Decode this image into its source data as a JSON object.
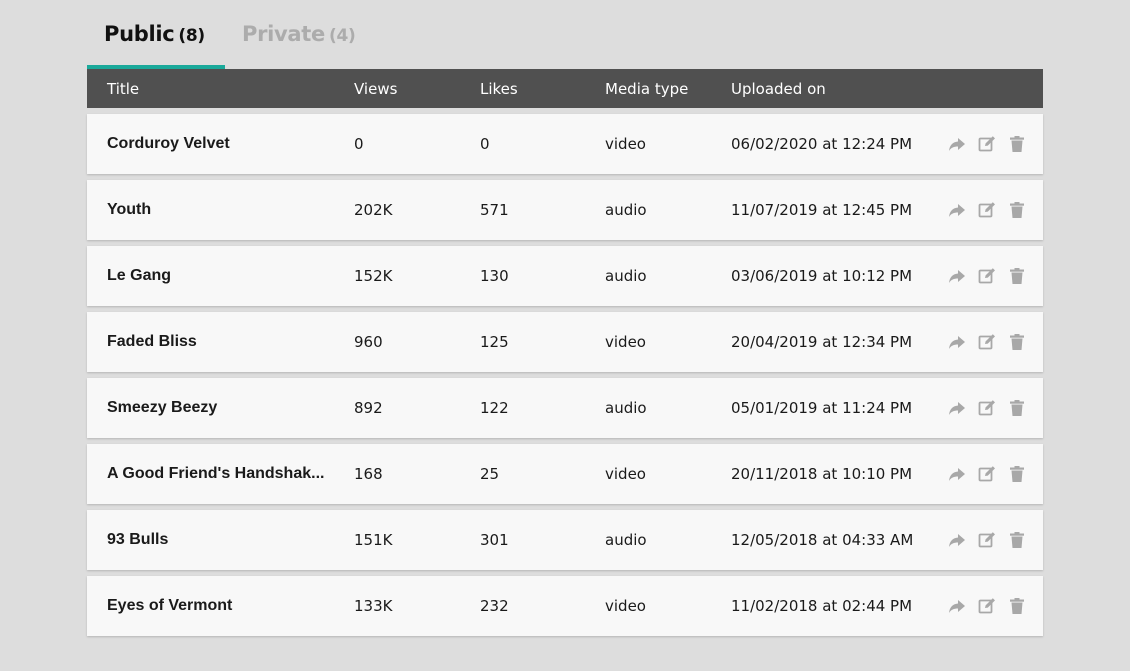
{
  "tabs": [
    {
      "label": "Public",
      "count": "(8)"
    },
    {
      "label": "Private",
      "count": "(4)"
    }
  ],
  "columns": [
    "Title",
    "Views",
    "Likes",
    "Media type",
    "Uploaded on"
  ],
  "rows": [
    {
      "title": "Corduroy Velvet",
      "views": "0",
      "likes": "0",
      "media": "video",
      "uploaded": "06/02/2020 at 12:24 PM"
    },
    {
      "title": "Youth",
      "views": "202K",
      "likes": "571",
      "media": "audio",
      "uploaded": "11/07/2019 at 12:45 PM"
    },
    {
      "title": "Le Gang",
      "views": "152K",
      "likes": "130",
      "media": "audio",
      "uploaded": "03/06/2019 at 10:12 PM"
    },
    {
      "title": "Faded Bliss",
      "views": "960",
      "likes": "125",
      "media": "video",
      "uploaded": "20/04/2019 at 12:34 PM"
    },
    {
      "title": "Smeezy Beezy",
      "views": "892",
      "likes": "122",
      "media": "audio",
      "uploaded": "05/01/2019 at 11:24 PM"
    },
    {
      "title": "A Good Friend's Handshak...",
      "views": "168",
      "likes": "25",
      "media": "video",
      "uploaded": "20/11/2018 at 10:10 PM"
    },
    {
      "title": "93 Bulls",
      "views": "151K",
      "likes": "301",
      "media": "audio",
      "uploaded": "12/05/2018 at 04:33 AM"
    },
    {
      "title": "Eyes of Vermont",
      "views": "133K",
      "likes": "232",
      "media": "video",
      "uploaded": "11/02/2018 at 02:44 PM"
    }
  ],
  "row_actions": [
    "share-icon",
    "edit-icon",
    "trash-icon"
  ],
  "colors": {
    "background": "#dddddd",
    "header": "#505050",
    "accent": "#1aa99a",
    "row": "#f8f8f8",
    "inactive_tab": "#acacac",
    "icon": "#a8a8a8"
  }
}
